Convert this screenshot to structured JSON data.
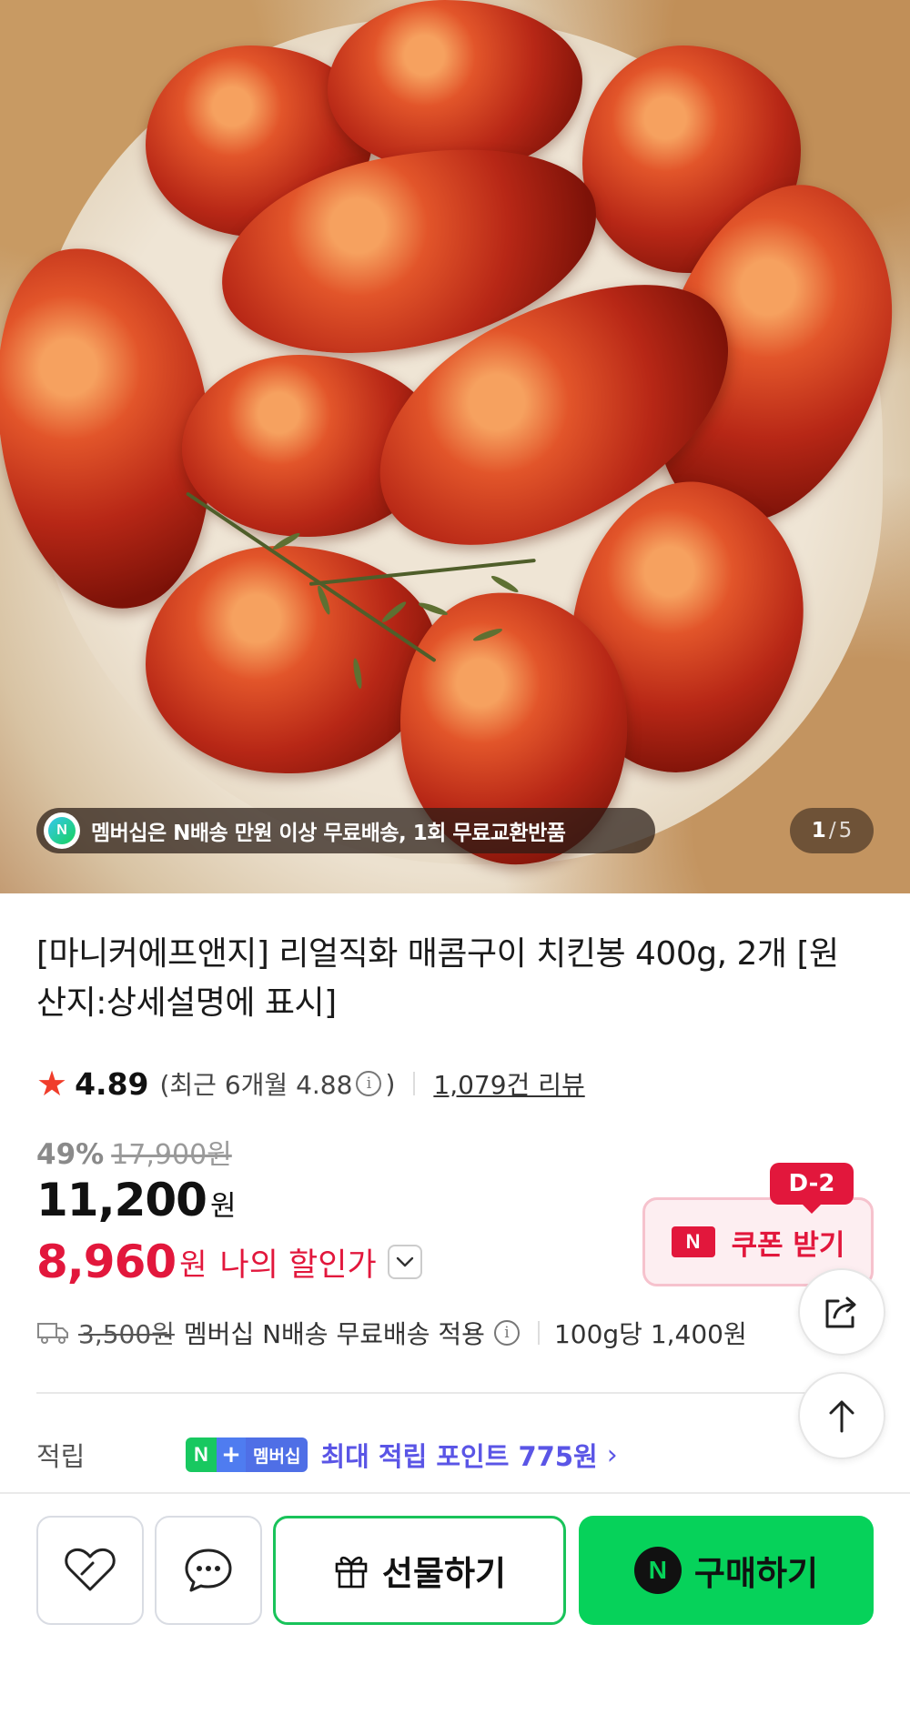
{
  "hero": {
    "promo_badge": "N",
    "promo_text": "멤버십은 N배송 만원 이상 무료배송, 1회 무료교환반품",
    "pager_current": "1",
    "pager_sep": "/",
    "pager_total": "5"
  },
  "product": {
    "title": "[마니커에프앤지] 리얼직화 매콤구이 치킨봉 400g, 2개 [원산지:상세설명에 표시]",
    "rating": {
      "star": "★",
      "score": "4.89",
      "recent_open": "(최근 6개월 4.88",
      "info": "i",
      "recent_close": ")",
      "reviews": "1,079건 리뷰"
    },
    "price": {
      "discount_rate": "49%",
      "original": "17,900원",
      "sale": "11,200",
      "sale_unit": "원",
      "my_price": "8,960",
      "my_price_unit": "원",
      "my_price_label": "나의 할인가",
      "my_price_toggle": "⌄"
    },
    "coupon": {
      "badge": "D-2",
      "icon": "N",
      "label": "쿠폰 받기"
    },
    "shipping": {
      "original_fee": "3,500원",
      "text": "멤버십 N배송 무료배송 적용",
      "info": "i",
      "unit_price": "100g당 1,400원"
    },
    "points": {
      "title": "적립",
      "badge_n": "N",
      "badge_plus": "+",
      "badge_member": "멤버십",
      "text": "최대 적립 포인트 775원",
      "chevron": "›"
    }
  },
  "actions": {
    "gift_label": "선물하기",
    "buy_icon": "N",
    "buy_label": "구매하기"
  },
  "colors": {
    "accent_red": "#e2173c",
    "naver_green": "#06d25a",
    "point_purple": "#5a55e6"
  },
  "icons": [
    "star-icon",
    "info-icon",
    "truck-icon",
    "share-icon",
    "arrow-up-icon",
    "heart-icon",
    "talk-icon",
    "gift-icon",
    "naver-n-icon",
    "chevron-down-icon",
    "chevron-right-icon"
  ]
}
